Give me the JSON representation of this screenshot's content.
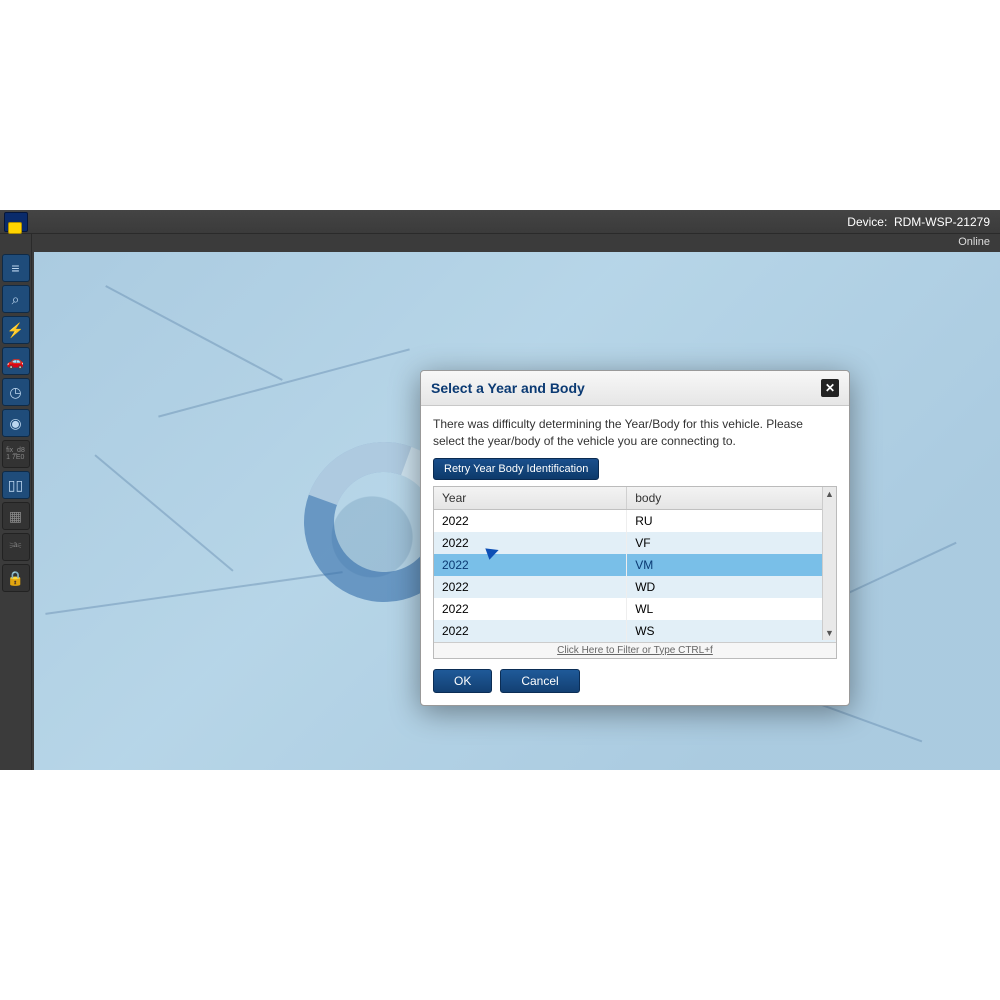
{
  "titlebar": {
    "device_label": "Device:",
    "device_name": "RDM-WSP-21279"
  },
  "status": {
    "connection": "Online"
  },
  "sidebar": {
    "items": [
      {
        "icon": "menu"
      },
      {
        "icon": "search-vehicle"
      },
      {
        "icon": "bolt"
      },
      {
        "icon": "car"
      },
      {
        "icon": "gauge"
      },
      {
        "icon": "signal"
      },
      {
        "icon": "hex-code",
        "muted": true
      },
      {
        "icon": "columns"
      },
      {
        "icon": "grid",
        "muted": true
      },
      {
        "icon": "flow",
        "muted": true
      },
      {
        "icon": "lock",
        "muted": true
      }
    ]
  },
  "dialog": {
    "title": "Select a Year and Body",
    "message": "There was difficulty determining the Year/Body for this vehicle. Please select the year/body of the vehicle you are connecting to.",
    "retry_label": "Retry Year Body Identification",
    "columns": {
      "year": "Year",
      "body": "body"
    },
    "rows": [
      {
        "year": "2022",
        "body": "RU"
      },
      {
        "year": "2022",
        "body": "VF"
      },
      {
        "year": "2022",
        "body": "VM",
        "selected": true
      },
      {
        "year": "2022",
        "body": "WD"
      },
      {
        "year": "2022",
        "body": "WL"
      },
      {
        "year": "2022",
        "body": "WS"
      }
    ],
    "filter_hint": "Click Here to Filter or Type CTRL+f",
    "ok_label": "OK",
    "cancel_label": "Cancel"
  }
}
